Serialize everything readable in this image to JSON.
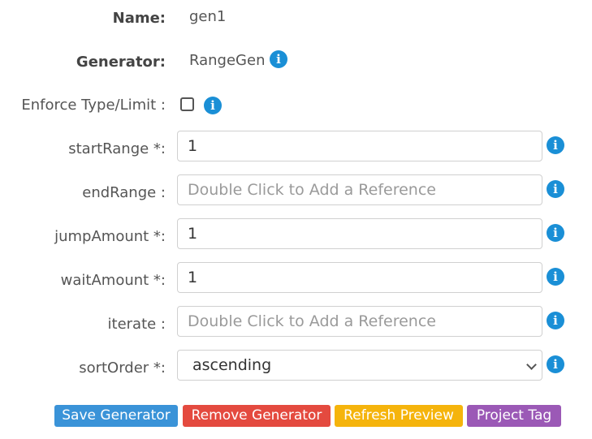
{
  "name_row": {
    "label": "Name:",
    "value": "gen1"
  },
  "generator_row": {
    "label": "Generator:",
    "value": "RangeGen"
  },
  "enforce_row": {
    "label": "Enforce Type/Limit :",
    "checked": false
  },
  "fields": [
    {
      "label": "startRange *:",
      "value": "1",
      "placeholder": ""
    },
    {
      "label": "endRange :",
      "value": "",
      "placeholder": "Double Click to Add a Reference"
    },
    {
      "label": "jumpAmount *:",
      "value": "1",
      "placeholder": ""
    },
    {
      "label": "waitAmount *:",
      "value": "1",
      "placeholder": ""
    },
    {
      "label": "iterate :",
      "value": "",
      "placeholder": "Double Click to Add a Reference"
    }
  ],
  "sort_row": {
    "label": "sortOrder *:",
    "selected": "ascending"
  },
  "info_glyph": "i",
  "icons": {
    "info": "info-circle-icon",
    "select_arrow": "chevron-down-icon"
  },
  "buttons": {
    "save": {
      "label": "Save Generator",
      "color": "#3a93d8"
    },
    "remove": {
      "label": "Remove Generator",
      "color": "#e44a3f"
    },
    "refresh": {
      "label": "Refresh Preview",
      "color": "#f5b40c"
    },
    "tag": {
      "label": "Project Tag",
      "color": "#9b59b6"
    }
  },
  "colors": {
    "info": "#1a8fd6"
  }
}
